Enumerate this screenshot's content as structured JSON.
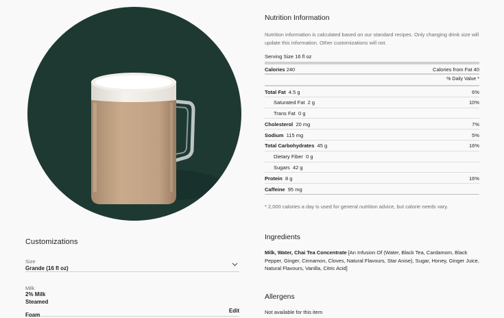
{
  "customizations": {
    "title": "Customizations",
    "size": {
      "label": "Size",
      "value": "Grande (16 fl oz)",
      "icon": "chevron-down-icon"
    },
    "milk": {
      "label": "Milk",
      "value": "2% Milk"
    },
    "steamed": "Steamed",
    "foam": {
      "label": "Foam",
      "edit": "Edit"
    }
  },
  "nutrition": {
    "title": "Nutrition Information",
    "description": "Nutrition information is calculated based on our standard recipes. Only changing drink size will update this information. Other customizations will not.",
    "serving": "Serving Size 16 fl oz",
    "calories": {
      "label": "Calories",
      "value": "240",
      "from_fat_label": "Calories from Fat",
      "from_fat_value": "40"
    },
    "daily_value_header": "% Daily Value *",
    "rows": [
      {
        "label": "Total Fat",
        "amount": "4.5 g",
        "pct": "6%",
        "bold": true,
        "sub": false
      },
      {
        "label": "Saturated Fat",
        "amount": "2 g",
        "pct": "10%",
        "bold": false,
        "sub": true
      },
      {
        "label": "Trans Fat",
        "amount": "0 g",
        "pct": "",
        "bold": false,
        "sub": true
      },
      {
        "label": "Cholesterol",
        "amount": "20 mg",
        "pct": "7%",
        "bold": true,
        "sub": false
      },
      {
        "label": "Sodium",
        "amount": "115 mg",
        "pct": "5%",
        "bold": true,
        "sub": false
      },
      {
        "label": "Total Carbohydrates",
        "amount": "45 g",
        "pct": "16%",
        "bold": true,
        "sub": false
      },
      {
        "label": "Dietary Fiber",
        "amount": "0 g",
        "pct": "",
        "bold": false,
        "sub": true
      },
      {
        "label": "Sugars",
        "amount": "42 g",
        "pct": "",
        "bold": false,
        "sub": true
      },
      {
        "label": "Protein",
        "amount": "8 g",
        "pct": "16%",
        "bold": true,
        "sub": false
      },
      {
        "label": "Caffeine",
        "amount": "95 mg",
        "pct": "",
        "bold": true,
        "sub": false
      }
    ],
    "footnote": "* 2,000 calories a day is used for general nutrition advice, but calorie needs vary."
  },
  "ingredients": {
    "title": "Ingredients",
    "bold_part": "Milk, Water, Chai Tea Concentrate",
    "rest": " [An Infusion Of (Water, Black Tea, Cardamom, Black Pepper, Ginger, Cinnamon, Cloves, Natural Flavours, Star Anise), Sugar, Honey, Ginger Juice, Natural Flavours, Vanilla, Citric Acid]"
  },
  "allergens": {
    "title": "Allergens",
    "text": "Not available for this item"
  },
  "colors": {
    "hero_bg": "#1e3932",
    "page_bg": "#f9f9f9"
  }
}
